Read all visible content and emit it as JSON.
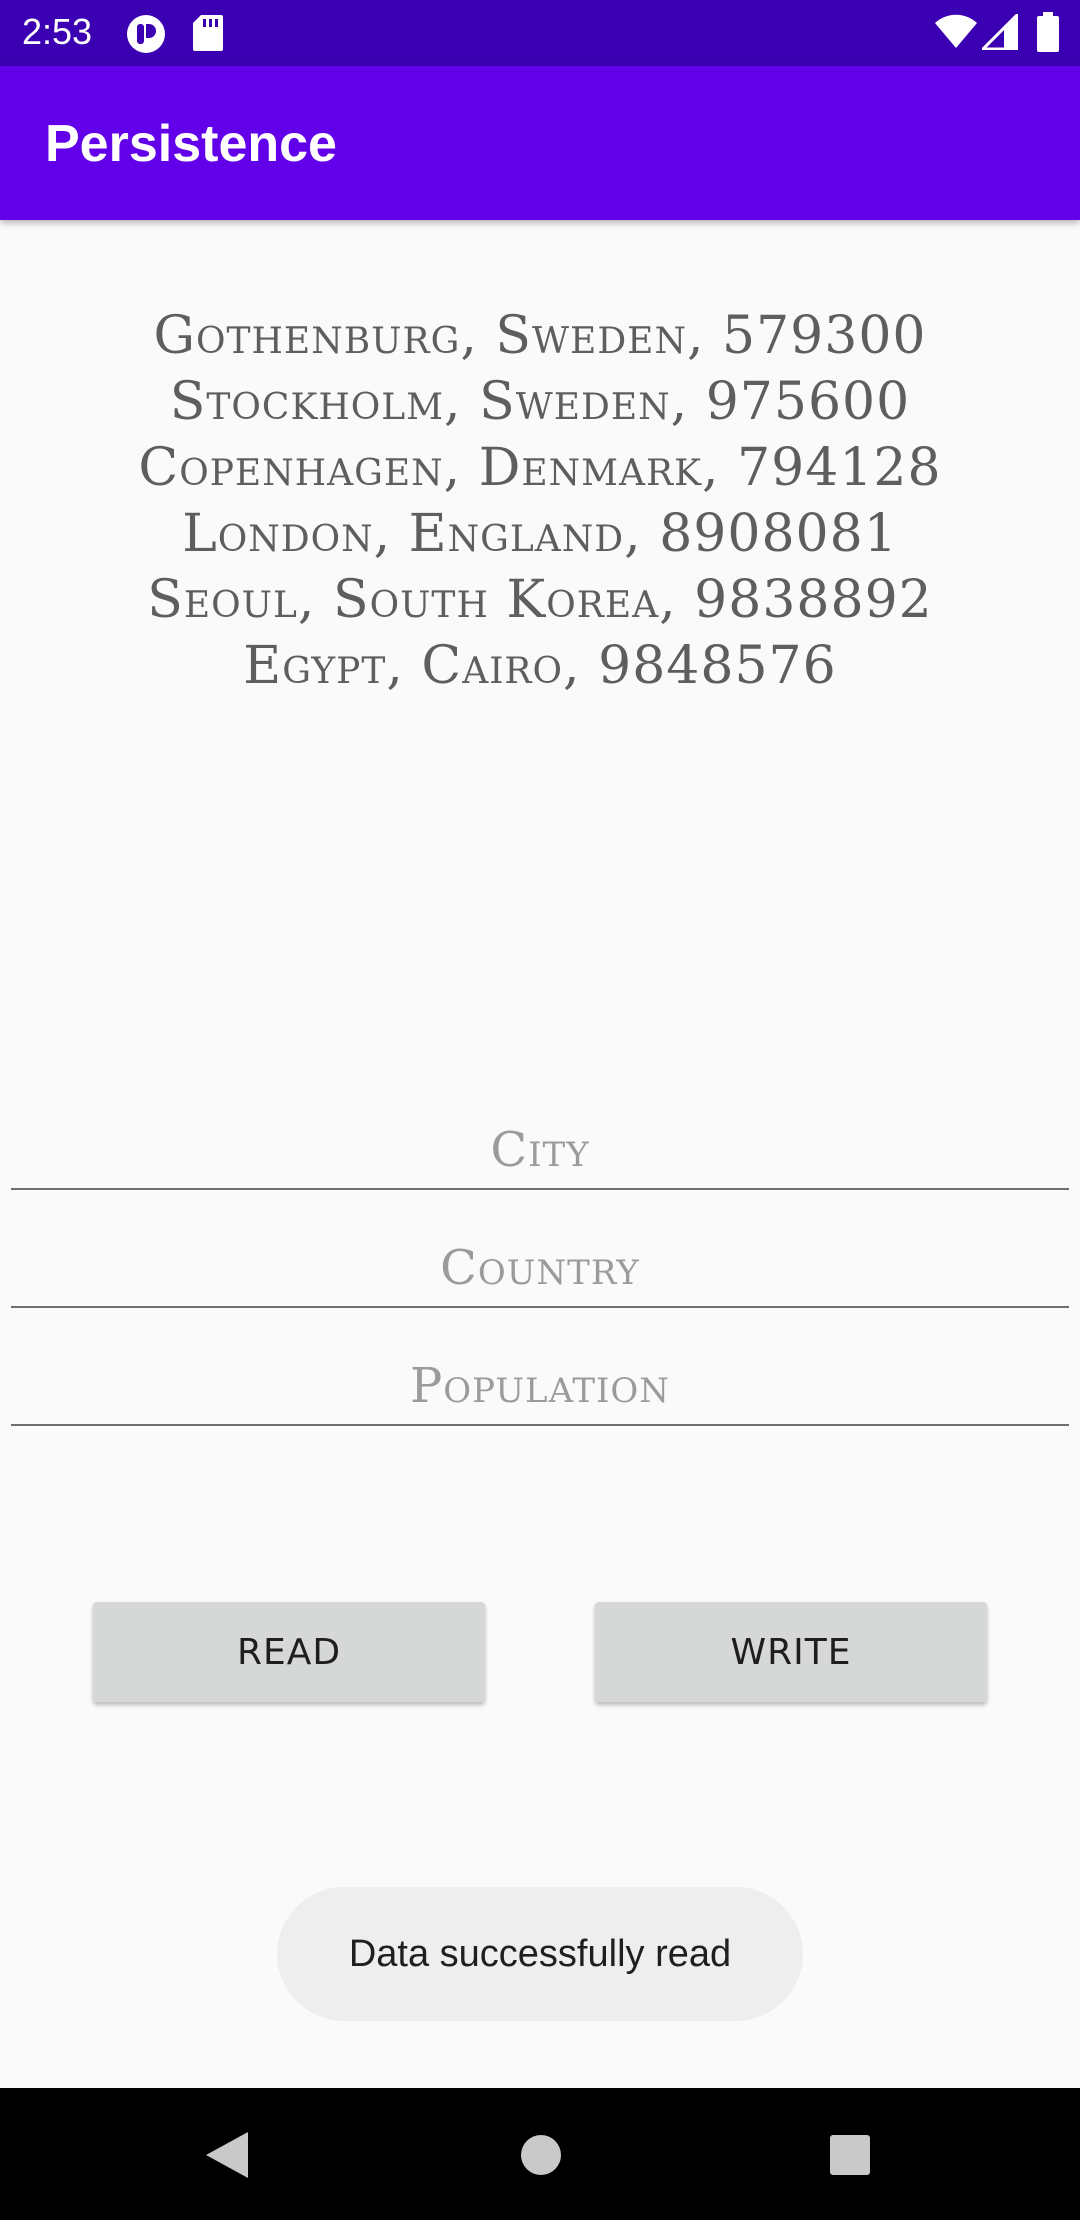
{
  "status_bar": {
    "time": "2:53"
  },
  "app_bar": {
    "title": "Persistence"
  },
  "cities": [
    "Gothenburg, Sweden, 579300",
    "Stockholm, Sweden, 975600",
    "Copenhagen, Denmark, 794128",
    "London, England, 8908081",
    "Seoul, South Korea, 9838892",
    "Egypt, Cairo, 9848576"
  ],
  "form": {
    "city_placeholder": "City",
    "country_placeholder": "Country",
    "population_placeholder": "Population",
    "city_value": "",
    "country_value": "",
    "population_value": ""
  },
  "buttons": {
    "read_label": "READ",
    "write_label": "WRITE"
  },
  "toast": {
    "message": "Data successfully read"
  },
  "colors": {
    "status_bar": "#3a00b2",
    "app_bar": "#6200ea",
    "background": "#fafafa",
    "button": "#d6d7d7",
    "toast": "#eeeeee",
    "nav_bar": "#000000"
  },
  "icons": {
    "status_left": [
      "notification-app-icon",
      "sd-card-icon"
    ],
    "status_right": [
      "wifi-icon",
      "cell-signal-icon",
      "battery-icon"
    ],
    "nav": [
      "back-icon",
      "home-icon",
      "recents-icon"
    ]
  }
}
